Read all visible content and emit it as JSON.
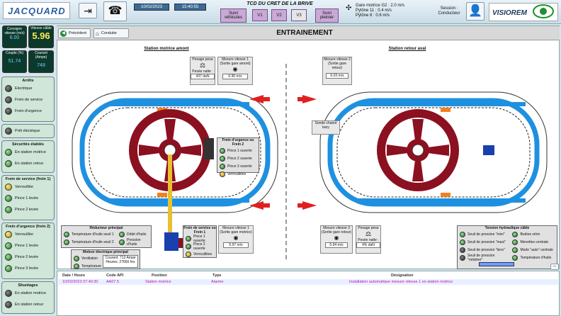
{
  "header": {
    "logo": "JACQUARD",
    "date": "10/02/2023",
    "time": "15:40:55",
    "line_title": "TCD DU CRET DE LA BRIVE",
    "suivi_vehicules": "Suivi véhicules",
    "v1": "V1",
    "v2": "V2",
    "v3": "V3",
    "suivi_pleinier": "Suivi pleinier",
    "gare_motrice": "Gare motrice G2 : 2.0 m/s",
    "pylone11": "Pylône 11     : 0.4 m/s",
    "pylone8": "Pylône 8      : 0.6 m/s",
    "session_label": "Session :",
    "session_user": "Conducteur",
    "visiorem": "VISIOREM"
  },
  "side": {
    "consigne_label": "Consigne vitesse (m/s)",
    "consigne_value": "6.00",
    "vitesse_label": "Vitesse câble",
    "vitesse_value": "5.96",
    "couple_label": "Couple (%)",
    "couple_value": "51.74",
    "courant_label": "Courant (Ampe)",
    "courant_value": "748",
    "arrets": {
      "title": "Arrêts",
      "items": [
        "Electrique",
        "Frein de service",
        "Frein d'urgence"
      ]
    },
    "pret": "Prêt électrique",
    "securites": {
      "title": "Sécurités élablés",
      "items": [
        "En station motrice",
        "En station retour"
      ]
    },
    "frein_service": {
      "title": "Frein de service (frein 1)",
      "items": [
        "Verrouillée",
        "Pince 1 levée",
        "Pince 2 levée"
      ]
    },
    "frein_urgence": {
      "title": "Frein d'urgence (frein 2)",
      "items": [
        "Verrouillée",
        "Pince 1 levée",
        "Pince 2 levée",
        "Pince 3 levée"
      ]
    },
    "shuntages": {
      "title": "Shuntages",
      "items": [
        "En station motrice",
        "En station retour"
      ]
    }
  },
  "main": {
    "precedent": "Précédent",
    "conduite": "Conduite",
    "title": "ENTRAINEMENT",
    "station_motrice": "Station motrice amont",
    "station_retour": "Station retour aval",
    "pesage_label": "Pesage pesa",
    "pesage_value": "Pesée natte :",
    "pesage_weight": "437 daN",
    "mesure1_title": "Mesure vitesse 1 (Sortie gare amont)",
    "mesure1_value": "6.90 m/s",
    "mesure2_title": "Mesure vitesse 2 (Sortie gare retour)",
    "mesure2_value": "6.03 m/s",
    "frein_urgence_panel": {
      "title": "Frein d'urgence ou Frein 2",
      "items": [
        "Pince 1 ouverte",
        "Pince 2 ouverte",
        "Pince 3 ouverte",
        "Verrouillées"
      ]
    },
    "sonde": "Sonde chariot bary",
    "tension_panel": {
      "title": "Tension hydraulique câble",
      "items": [
        "Seuil de pression \"mini\"",
        "Seuil de pression \"maxi\"",
        "Seuil de pression \"tiers\"",
        "Seuil de pression \"rotiisher\"",
        "Butées vérin",
        "Menettes centrale",
        "Mode \"auto\" centrale",
        "Température d'huile"
      ]
    },
    "reducteur_panel": {
      "title": "Réducteur principal",
      "items": [
        "Température d'huile seuil 1",
        "Température d'huile seuil 2",
        "Débit d'huile",
        "Pression d'huile"
      ]
    },
    "moteur_panel": {
      "title": "Moteur électrique principal",
      "items": [
        "Ventilation",
        "Température"
      ],
      "courant": "Courant: 712 Ampe",
      "heures": "Heures: 27666 hrs"
    },
    "frein_service_panel": {
      "title": "Frein de service ou Frein 1",
      "items": [
        "Pince 1 ouverte",
        "Pince 2 ouverte",
        "Verrouillées"
      ]
    },
    "mesure1b_title": "Mesure vitesse 1 (Sortie gare motrice)",
    "mesure1b_value": "5.97 m/s",
    "mesure3_title": "Mesure vitesse 3 (Sortie gare retour)",
    "mesure3_value": "5.94 m/s",
    "pesage2_label": "Pesage pesa",
    "pesage2_value": "Pesée natte :",
    "pesage2_weight": "4% daN"
  },
  "footer": {
    "headers": [
      "Date / Heure",
      "Code API",
      "Position",
      "Type",
      "Désignation"
    ],
    "row": [
      "10/02/2023 07:40:30",
      "AA07.5",
      "Station motrice",
      "Alarme",
      "Installation automatique mesure vitesse 1 en station motrice"
    ]
  }
}
